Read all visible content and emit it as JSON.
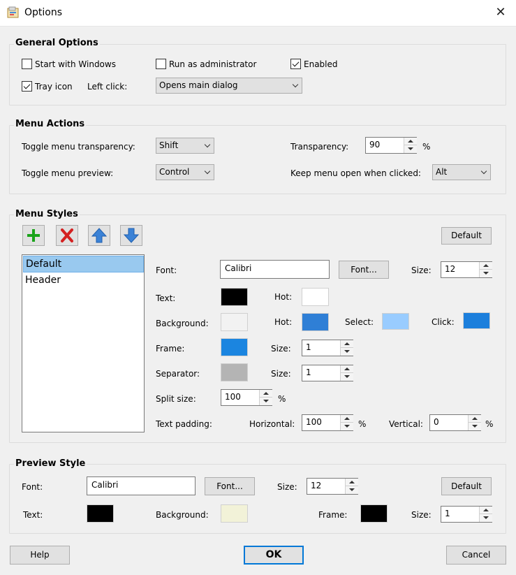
{
  "window": {
    "title": "Options"
  },
  "general": {
    "title": "General Options",
    "start_with_windows": {
      "label": "Start with Windows",
      "checked": false
    },
    "run_as_admin": {
      "label": "Run as administrator",
      "checked": false
    },
    "enabled": {
      "label": "Enabled",
      "checked": true
    },
    "tray_icon": {
      "label": "Tray icon",
      "checked": true
    },
    "left_click_label": "Left click:",
    "left_click_value": "Opens main dialog"
  },
  "menu_actions": {
    "title": "Menu Actions",
    "toggle_transparency_label": "Toggle menu transparency:",
    "toggle_transparency_value": "Shift",
    "transparency_label": "Transparency:",
    "transparency_value": "90",
    "transparency_unit": "%",
    "toggle_preview_label": "Toggle menu preview:",
    "toggle_preview_value": "Control",
    "keep_open_label": "Keep menu open when clicked:",
    "keep_open_value": "Alt"
  },
  "menu_styles": {
    "title": "Menu Styles",
    "default_button": "Default",
    "styles": [
      {
        "label": "Default",
        "selected": true
      },
      {
        "label": "Header",
        "selected": false
      }
    ],
    "font_label": "Font:",
    "font_value": "Calibri",
    "font_button": "Font...",
    "size_label": "Size:",
    "size_value": "12",
    "text_label": "Text:",
    "hot_label": "Hot:",
    "background_label": "Background:",
    "select_label": "Select:",
    "click_label": "Click:",
    "frame_label": "Frame:",
    "frame_size_value": "1",
    "separator_label": "Separator:",
    "separator_size_value": "1",
    "split_size_label": "Split size:",
    "split_size_value": "100",
    "split_size_unit": "%",
    "text_padding_label": "Text padding:",
    "horizontal_label": "Horizontal:",
    "horizontal_value": "100",
    "horizontal_unit": "%",
    "vertical_label": "Vertical:",
    "vertical_value": "0",
    "vertical_unit": "%",
    "colors": {
      "text": "#000000",
      "text_hot": "#ffffff",
      "background": "#f2f2f2",
      "background_hot": "#2f7fd6",
      "select": "#99ccff",
      "click": "#1c7fdc",
      "frame": "#1b85e0",
      "separator": "#b4b4b4"
    }
  },
  "preview": {
    "title": "Preview Style",
    "font_label": "Font:",
    "font_value": "Calibri",
    "font_button": "Font...",
    "size_label": "Size:",
    "size_value": "12",
    "default_button": "Default",
    "text_label": "Text:",
    "background_label": "Background:",
    "frame_label": "Frame:",
    "frame_size_label": "Size:",
    "frame_size_value": "1",
    "colors": {
      "text": "#000000",
      "background": "#f2f2d8",
      "frame": "#000000"
    }
  },
  "buttons": {
    "help": "Help",
    "ok": "OK",
    "cancel": "Cancel"
  }
}
